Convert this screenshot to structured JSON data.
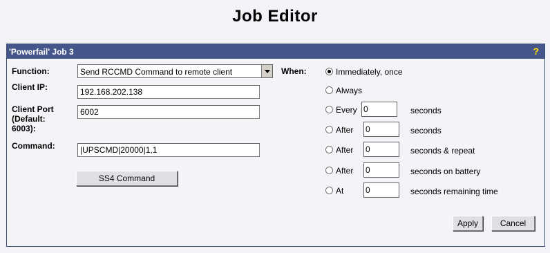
{
  "page": {
    "title": "Job Editor"
  },
  "panel": {
    "title": "'Powerfail' Job 3",
    "help": "?"
  },
  "form": {
    "function_label": "Function:",
    "function_value": "Send RCCMD Command to remote client",
    "client_ip_label": "Client IP:",
    "client_ip_value": "192.168.202.138",
    "client_port_label_1": "Client Port",
    "client_port_label_2": "(Default:",
    "client_port_label_3": "6003):",
    "client_port_value": "6002",
    "command_label": "Command:",
    "command_value": "|UPSCMD|20000|1,1",
    "ss4_button": "SS4 Command"
  },
  "when": {
    "label": "When:",
    "options": [
      {
        "label": "Immediately, once",
        "selected": true
      },
      {
        "label": "Always",
        "selected": false
      },
      {
        "label": "Every",
        "value": "0",
        "unit": "seconds",
        "selected": false
      },
      {
        "label": "After",
        "value": "0",
        "unit": "seconds",
        "selected": false
      },
      {
        "label": "After",
        "value": "0",
        "unit": "seconds & repeat",
        "selected": false
      },
      {
        "label": "After",
        "value": "0",
        "unit": "seconds on battery",
        "selected": false
      },
      {
        "label": "At",
        "value": "0",
        "unit": "seconds remaining time",
        "selected": false
      }
    ]
  },
  "actions": {
    "apply": "Apply",
    "cancel": "Cancel"
  }
}
